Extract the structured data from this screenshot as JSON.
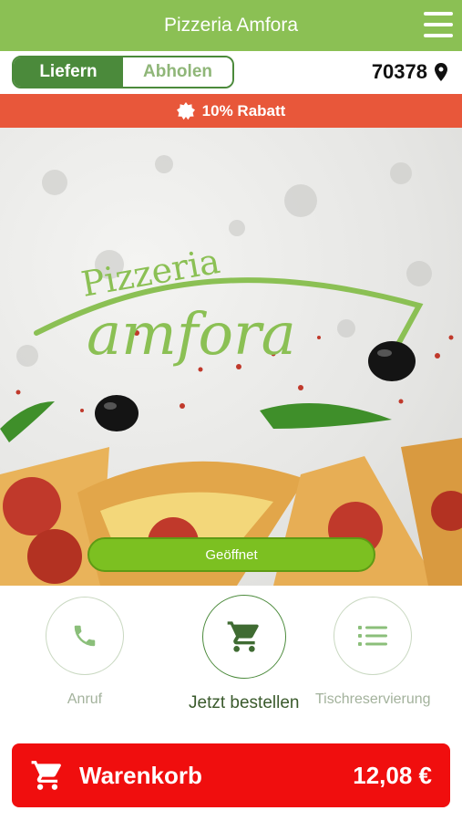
{
  "header": {
    "title": "Pizzeria Amfora"
  },
  "order_mode": {
    "deliver_label": "Liefern",
    "pickup_label": "Abholen",
    "selected": "Liefern"
  },
  "location": {
    "zip": "70378"
  },
  "promo": {
    "label": "10% Rabatt"
  },
  "hero": {
    "logo_small": "Pizzeria",
    "logo_large": "amfora",
    "status": "Geöffnet"
  },
  "actions": {
    "call_label": "Anruf",
    "order_label": "Jetzt bestellen",
    "reserve_label": "Tischreservierung"
  },
  "cart": {
    "label": "Warenkorb",
    "total": "12,08 €"
  },
  "colors": {
    "brand_green": "#8bc054",
    "dark_green": "#4b8a3b",
    "promo_red": "#e8573a",
    "cart_red": "#f00e0e",
    "status_green": "#7cc021"
  }
}
